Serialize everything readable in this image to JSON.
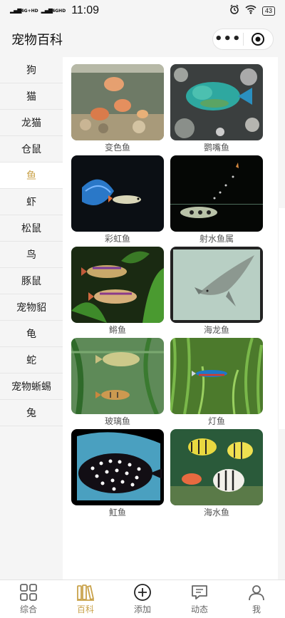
{
  "status": {
    "net1": "4G+HD",
    "net2": "4GHD",
    "time": "11:09",
    "battery": "43"
  },
  "header": {
    "title": "宠物百科"
  },
  "categories": [
    "狗",
    "猫",
    "龙猫",
    "仓鼠",
    "鱼",
    "虾",
    "松鼠",
    "鸟",
    "豚鼠",
    "宠物貂",
    "龟",
    "蛇",
    "宠物蜥蜴",
    "兔"
  ],
  "active_category": "鱼",
  "items": [
    {
      "label": "变色鱼"
    },
    {
      "label": "鹦嘴鱼"
    },
    {
      "label": "彩虹鱼"
    },
    {
      "label": "射水鱼属"
    },
    {
      "label": "鳉鱼"
    },
    {
      "label": "海龙鱼"
    },
    {
      "label": "玻璃鱼"
    },
    {
      "label": "灯鱼"
    },
    {
      "label": "魟鱼"
    },
    {
      "label": "海水鱼"
    }
  ],
  "tabs": [
    {
      "label": "综合",
      "icon": "grid-icon"
    },
    {
      "label": "百科",
      "icon": "books-icon"
    },
    {
      "label": "添加",
      "icon": "plus-circle-icon"
    },
    {
      "label": "动态",
      "icon": "chat-icon"
    },
    {
      "label": "我",
      "icon": "person-icon"
    }
  ],
  "colors": {
    "accent": "#c9a24a",
    "inactive": "#666666"
  }
}
